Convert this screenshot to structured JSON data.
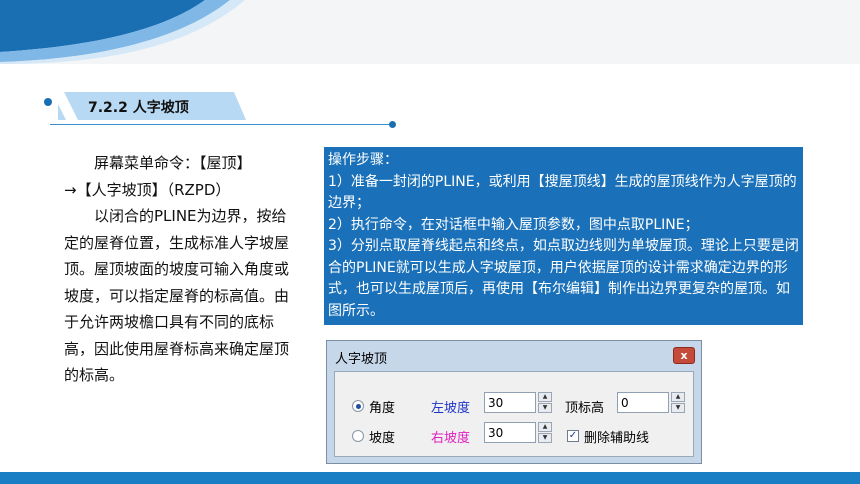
{
  "section": {
    "title": "7.2.2 人字坡顶"
  },
  "left_text": {
    "line1": "屏幕菜单命令：【屋顶】",
    "line2": "→【人字坡顶】（RZPD）",
    "paragraph": "以闭合的PLINE为边界，按给定的屋脊位置，生成标准人字坡屋顶。屋顶坡面的坡度可输入角度或坡度，可以指定屋脊的标高值。由于允许两坡檐口具有不同的底标高，因此使用屋脊标高来确定屋顶的标高。"
  },
  "steps_box": {
    "heading": "操作步骤：",
    "step1": "1）准备一封闭的PLINE，或利用【搜屋顶线】生成的屋顶线作为人字屋顶的边界；",
    "step2": "2）执行命令，在对话框中输入屋顶参数，图中点取PLINE；",
    "step3": "3）分别点取屋脊线起点和终点，如点取边线则为单坡屋顶。理论上只要是闭合的PLINE就可以生成人字坡屋顶，用户依据屋顶的设计需求确定边界的形式，也可以生成屋顶后，再使用【布尔编辑】制作出边界更复杂的屋顶。如图所示。"
  },
  "dialog": {
    "title": "人字坡顶",
    "close": "x",
    "radio_angle": "角度",
    "radio_slope": "坡度",
    "left_slope_label": "左坡度",
    "left_slope_value": "30",
    "right_slope_label": "右坡度",
    "right_slope_value": "30",
    "ridge_label": "顶标高",
    "ridge_value": "0",
    "delete_aux_label": "删除辅助线",
    "spin_up": "▲",
    "spin_down": "▼",
    "check_mark": "✓"
  },
  "colors": {
    "accent_blue": "#1a71b9",
    "tab_light_blue": "#b7d9f3",
    "dialog_frame": "#c7d7ea",
    "left_slope_blue": "#1f35c9",
    "right_slope_magenta": "#e020c0"
  }
}
